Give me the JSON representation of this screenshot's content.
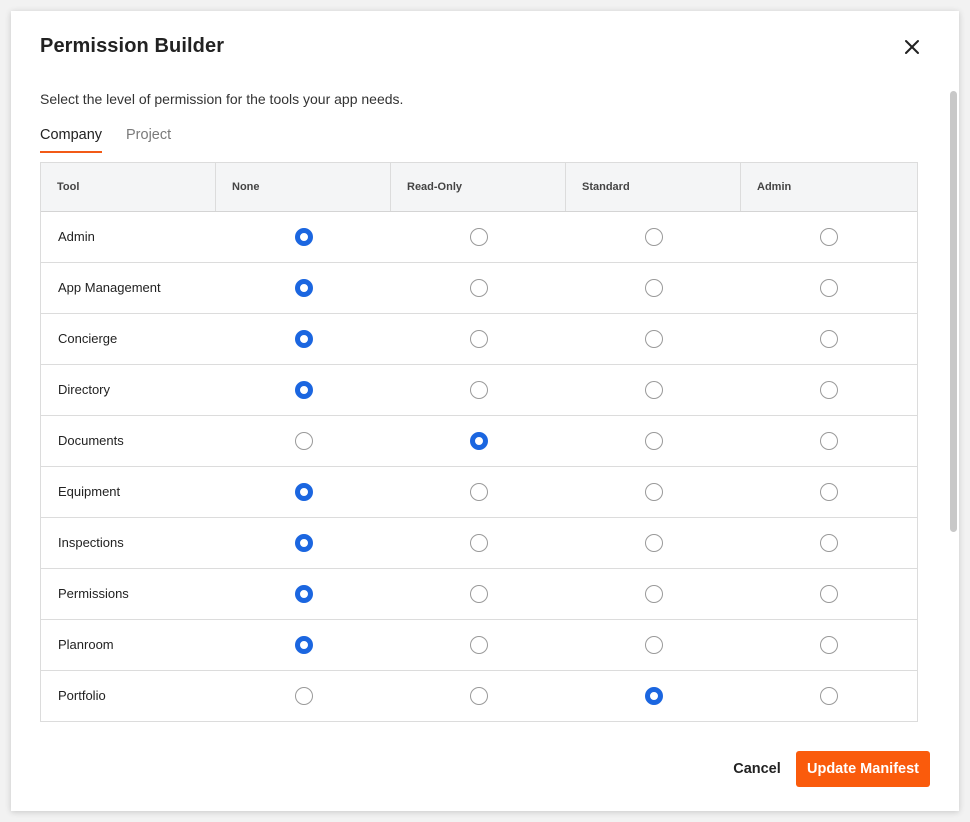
{
  "dialog": {
    "title": "Permission Builder",
    "description": "Select the level of permission for the tools your app needs.",
    "close_icon": "close-icon"
  },
  "tabs": [
    {
      "label": "Company",
      "active": true
    },
    {
      "label": "Project",
      "active": false
    }
  ],
  "table": {
    "columns": [
      "Tool",
      "None",
      "Read-Only",
      "Standard",
      "Admin"
    ],
    "levels": [
      "None",
      "Read-Only",
      "Standard",
      "Admin"
    ],
    "rows": [
      {
        "tool": "Admin",
        "selected": "None"
      },
      {
        "tool": "App Management",
        "selected": "None"
      },
      {
        "tool": "Concierge",
        "selected": "None"
      },
      {
        "tool": "Directory",
        "selected": "None"
      },
      {
        "tool": "Documents",
        "selected": "Read-Only"
      },
      {
        "tool": "Equipment",
        "selected": "None"
      },
      {
        "tool": "Inspections",
        "selected": "None"
      },
      {
        "tool": "Permissions",
        "selected": "None"
      },
      {
        "tool": "Planroom",
        "selected": "None"
      },
      {
        "tool": "Portfolio",
        "selected": "Standard"
      }
    ]
  },
  "footer": {
    "cancel_label": "Cancel",
    "submit_label": "Update Manifest"
  },
  "colors": {
    "accent": "#fa5b0c",
    "radio_selected": "#1b66e0",
    "tab_underline": "#f25a16"
  }
}
